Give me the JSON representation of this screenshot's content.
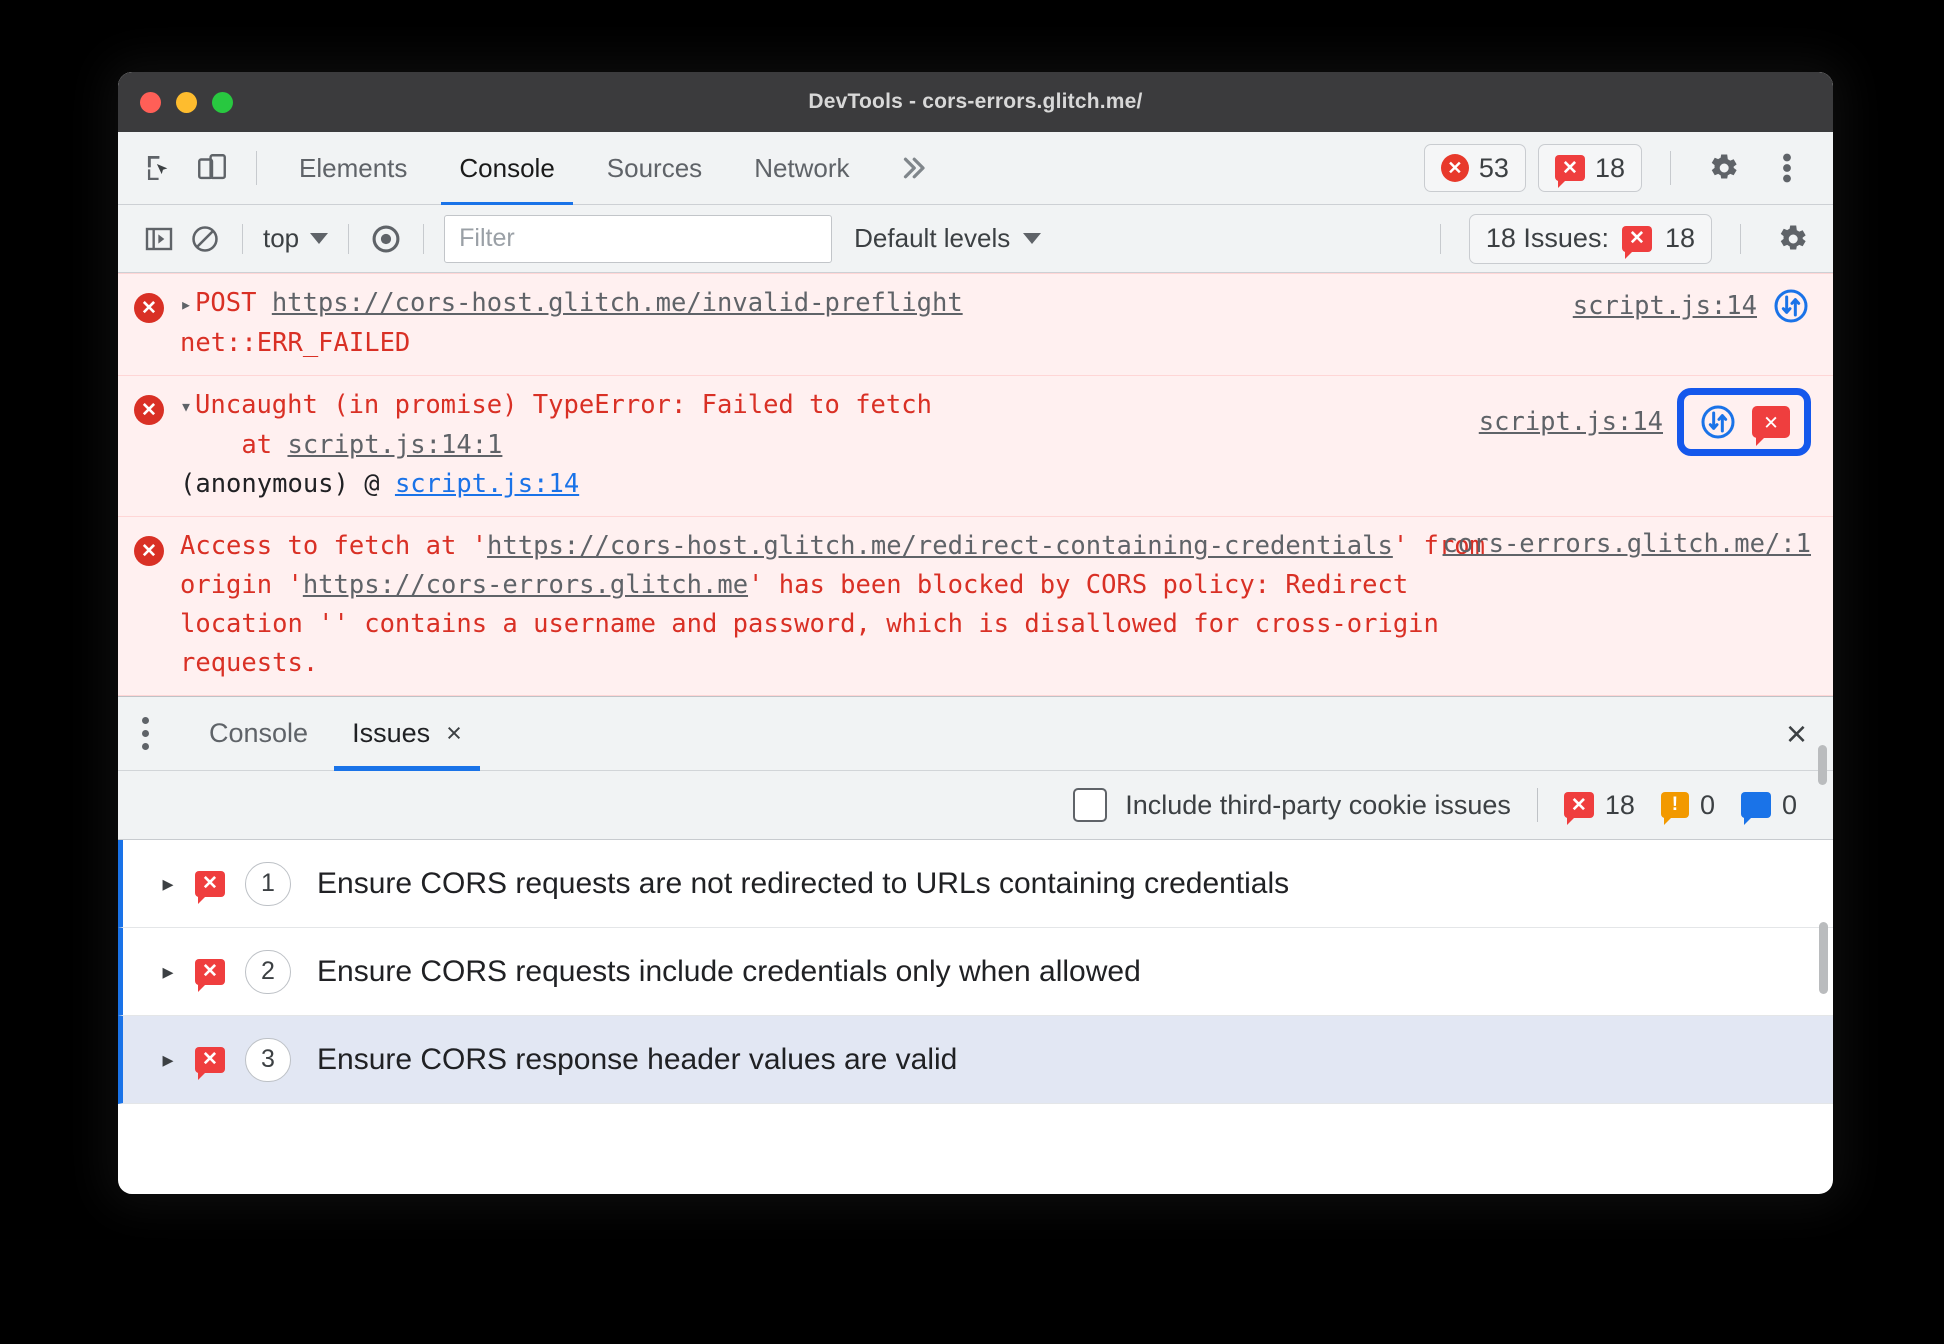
{
  "window": {
    "title": "DevTools - cors-errors.glitch.me/",
    "traffic_lights": [
      "close",
      "minimize",
      "maximize"
    ]
  },
  "tabstrip": {
    "icons": [
      {
        "name": "inspect-element-icon"
      },
      {
        "name": "device-toolbar-icon"
      }
    ],
    "tabs": [
      {
        "label": "Elements",
        "active": false
      },
      {
        "label": "Console",
        "active": true
      },
      {
        "label": "Sources",
        "active": false
      },
      {
        "label": "Network",
        "active": false
      }
    ],
    "more_tabs": "»",
    "error_count": "53",
    "issue_count": "18",
    "settings_icon": "gear-icon",
    "menu_icon": "three-dot-menu-icon"
  },
  "console_toolbar": {
    "sidebar_toggle": "console-sidebar-icon",
    "clear_console": "clear-console-icon",
    "context": "top",
    "eye_icon": "live-expression-eye-icon",
    "filter_placeholder": "Filter",
    "filter_value": "",
    "levels": "Default levels",
    "issues_label": "18 Issues:",
    "issues_count": "18",
    "settings_icon": "console-settings-gear-icon"
  },
  "console_messages": [
    {
      "id": "msg-post-failed",
      "expander": "▸",
      "line1_prefix": "POST ",
      "line1_link": "https://cors-host.glitch.me/invalid-preflight",
      "line2": "net::ERR_FAILED",
      "source": "script.js:14",
      "has_network_icon": true,
      "highlighted": false
    },
    {
      "id": "msg-uncaught-typeerror",
      "expander": "▾",
      "line1": "Uncaught (in promise) TypeError: Failed to fetch",
      "line2_prefix": "    at ",
      "line2_link": "script.js:14:1",
      "line3_prefix": "(anonymous) @ ",
      "line3_link": "script.js:14",
      "source": "script.js:14",
      "has_network_icon": true,
      "has_issue_badge": true,
      "highlighted": true
    },
    {
      "id": "msg-cors-blocked",
      "text_part1": "Access to fetch at '",
      "link1": "https://cors-host.glitch.me/redirect-containing-credentials",
      "text_part2": "' from origin '",
      "link2": "https://cors-errors.glitch.me",
      "text_part3": "' has been blocked by CORS policy: Redirect location '' contains a username and password, which is disallowed for cross-origin requests.",
      "source": "cors-errors.glitch.me/:1",
      "highlighted": false
    }
  ],
  "drawer": {
    "menu_icon": "drawer-menu-icon",
    "tabs": [
      {
        "label": "Console",
        "active": false,
        "closable": false
      },
      {
        "label": "Issues",
        "active": true,
        "closable": true,
        "close_glyph": "×"
      }
    ],
    "close_glyph": "×",
    "filter_bar": {
      "checkbox_label": "Include third-party cookie issues",
      "checkbox_checked": false,
      "error_count": "18",
      "warning_count": "0",
      "info_count": "0"
    },
    "issues": [
      {
        "expander": "▸",
        "severity": "error",
        "count": "1",
        "title": "Ensure CORS requests are not redirected to URLs containing credentials",
        "selected": false
      },
      {
        "expander": "▸",
        "severity": "error",
        "count": "2",
        "title": "Ensure CORS requests include credentials only when allowed",
        "selected": false
      },
      {
        "expander": "▸",
        "severity": "error",
        "count": "3",
        "title": "Ensure CORS response header values are valid",
        "selected": true
      }
    ]
  },
  "colors": {
    "accent_blue": "#1a73e8",
    "highlight_blue": "#1558ec",
    "error_red": "#d93025",
    "issue_red": "#ef3e3e",
    "error_bg": "#fff0f0",
    "toolbar_bg": "#f1f3f4",
    "titlebar_bg": "#3b3b3d"
  }
}
